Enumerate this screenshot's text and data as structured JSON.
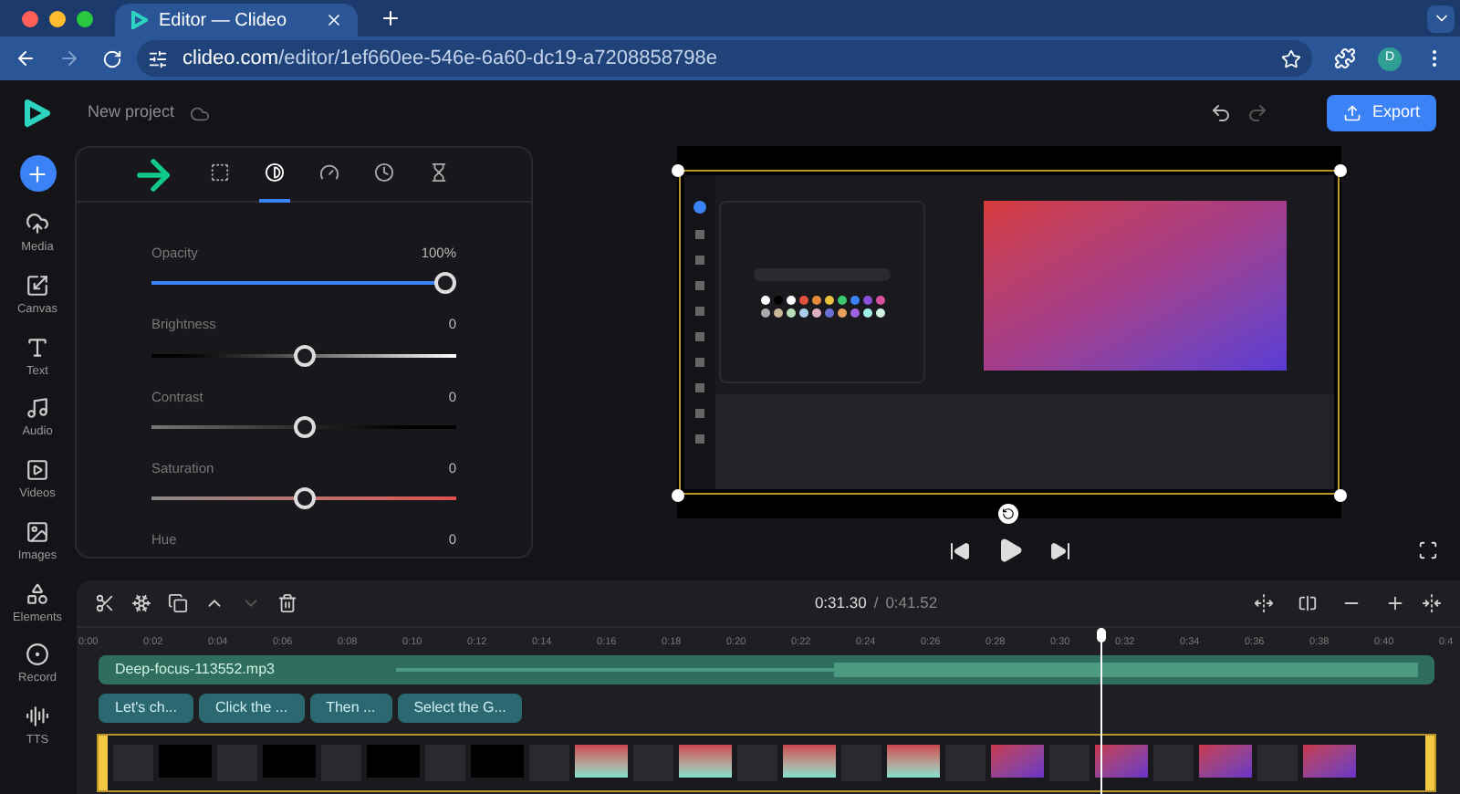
{
  "browser": {
    "tab_title": "Editor — Clideo",
    "url_host": "clideo.com",
    "url_path": "/editor/1ef660ee-546e-6a60-dc19-a7208858798e",
    "profile_initial": "D"
  },
  "header": {
    "project_name": "New project",
    "export_label": "Export"
  },
  "sidebar": {
    "items": [
      {
        "label": "Media"
      },
      {
        "label": "Canvas"
      },
      {
        "label": "Text"
      },
      {
        "label": "Audio"
      },
      {
        "label": "Videos"
      },
      {
        "label": "Images"
      },
      {
        "label": "Elements"
      },
      {
        "label": "Record"
      },
      {
        "label": "TTS"
      }
    ]
  },
  "panel": {
    "tabs": [
      {
        "selected": false
      },
      {
        "selected": true
      },
      {
        "selected": false
      },
      {
        "selected": false
      },
      {
        "selected": false
      }
    ],
    "sliders": [
      {
        "kind": "opacity",
        "label": "Opacity",
        "reading": "100%",
        "level": 1
      },
      {
        "kind": "brightness",
        "label": "Brightness",
        "reading": "0",
        "level": 0.5
      },
      {
        "kind": "contrast",
        "label": "Contrast",
        "reading": "0",
        "level": 0.5
      },
      {
        "kind": "saturation",
        "label": "Saturation",
        "reading": "0",
        "level": 0.5
      },
      {
        "kind": "hue",
        "label": "Hue",
        "reading": "0"
      }
    ]
  },
  "timeline": {
    "tools": [
      {
        "disabled": false
      },
      {
        "disabled": false
      },
      {
        "disabled": false
      },
      {
        "disabled": false
      },
      {
        "disabled": true
      },
      {
        "disabled": false
      }
    ],
    "current_time": "0:31.30",
    "separator": "/",
    "total_time": "0:41.52",
    "ticks": [
      "0:00",
      "0:02",
      "0:04",
      "0:06",
      "0:08",
      "0:10",
      "0:12",
      "0:14",
      "0:16",
      "0:18",
      "0:20",
      "0:22",
      "0:24",
      "0:26",
      "0:28",
      "0:30",
      "0:32",
      "0:34",
      "0:36",
      "0:38",
      "0:40",
      "0:4"
    ],
    "audio_clip": "Deep-focus-113552.mp3",
    "text_clips": [
      "Let's ch...",
      "Click the ...",
      "Then ...",
      "Select the G..."
    ]
  }
}
